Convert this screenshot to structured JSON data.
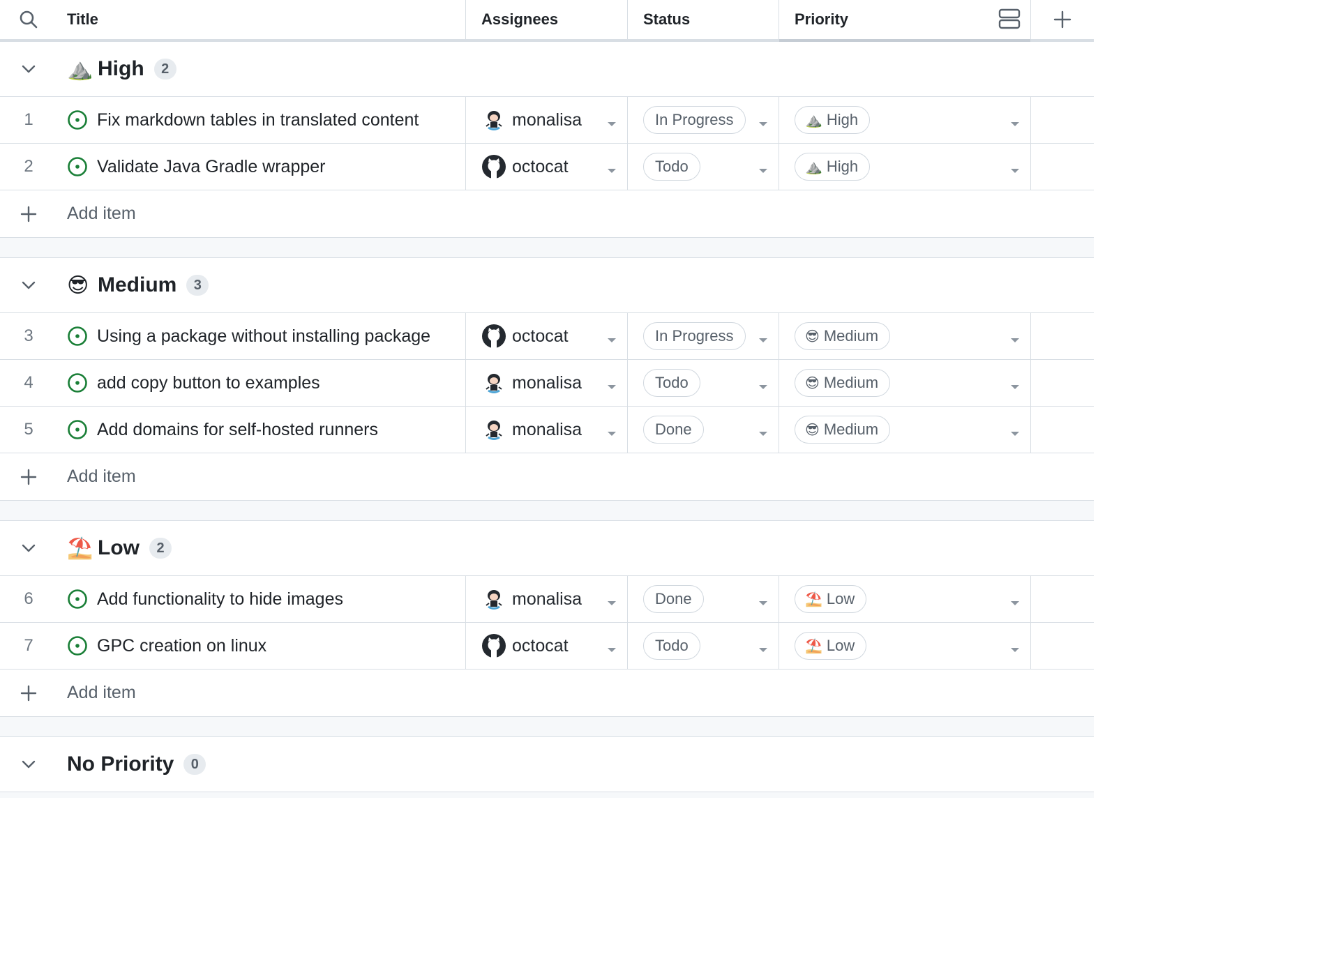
{
  "header": {
    "title": "Title",
    "assignees": "Assignees",
    "status": "Status",
    "priority": "Priority"
  },
  "add_item_label": "Add item",
  "groups": [
    {
      "emoji": "⛰️",
      "name": "High",
      "count": "2",
      "rows": [
        {
          "index": "1",
          "title": "Fix markdown tables in translated content",
          "assignee": "monalisa",
          "avatar": "monalisa",
          "status": "In Progress",
          "priority_emoji": "⛰️",
          "priority": "High"
        },
        {
          "index": "2",
          "title": "Validate Java Gradle wrapper",
          "assignee": "octocat",
          "avatar": "octocat",
          "status": "Todo",
          "priority_emoji": "⛰️",
          "priority": "High"
        }
      ]
    },
    {
      "emoji": "😎",
      "name": "Medium",
      "count": "3",
      "rows": [
        {
          "index": "3",
          "title": "Using a package without installing package",
          "assignee": "octocat",
          "avatar": "octocat",
          "status": "In Progress",
          "priority_emoji": "😎",
          "priority": "Medium"
        },
        {
          "index": "4",
          "title": "add copy button to examples",
          "assignee": "monalisa",
          "avatar": "monalisa",
          "status": "Todo",
          "priority_emoji": "😎",
          "priority": "Medium"
        },
        {
          "index": "5",
          "title": "Add domains for self-hosted runners",
          "assignee": "monalisa",
          "avatar": "monalisa",
          "status": "Done",
          "priority_emoji": "😎",
          "priority": "Medium"
        }
      ]
    },
    {
      "emoji": "⛱️",
      "name": "Low",
      "count": "2",
      "rows": [
        {
          "index": "6",
          "title": "Add functionality to hide images",
          "assignee": "monalisa",
          "avatar": "monalisa",
          "status": "Done",
          "priority_emoji": "⛱️",
          "priority": "Low"
        },
        {
          "index": "7",
          "title": "GPC creation on linux",
          "assignee": "octocat",
          "avatar": "octocat",
          "status": "Todo",
          "priority_emoji": "⛱️",
          "priority": "Low"
        }
      ]
    },
    {
      "emoji": "",
      "name": "No Priority",
      "count": "0",
      "rows": []
    }
  ],
  "colors": {
    "open_issue": "#1a7f37",
    "border": "#d8dee4",
    "muted_text": "#57606a",
    "count_bg": "#e7ebef"
  },
  "icons": {
    "search": "search-icon",
    "layout": "rows-layout-icon",
    "add_field": "plus-icon",
    "collapse": "chevron-down-icon",
    "issue": "issue-opened-icon",
    "add_item": "plus-icon"
  }
}
